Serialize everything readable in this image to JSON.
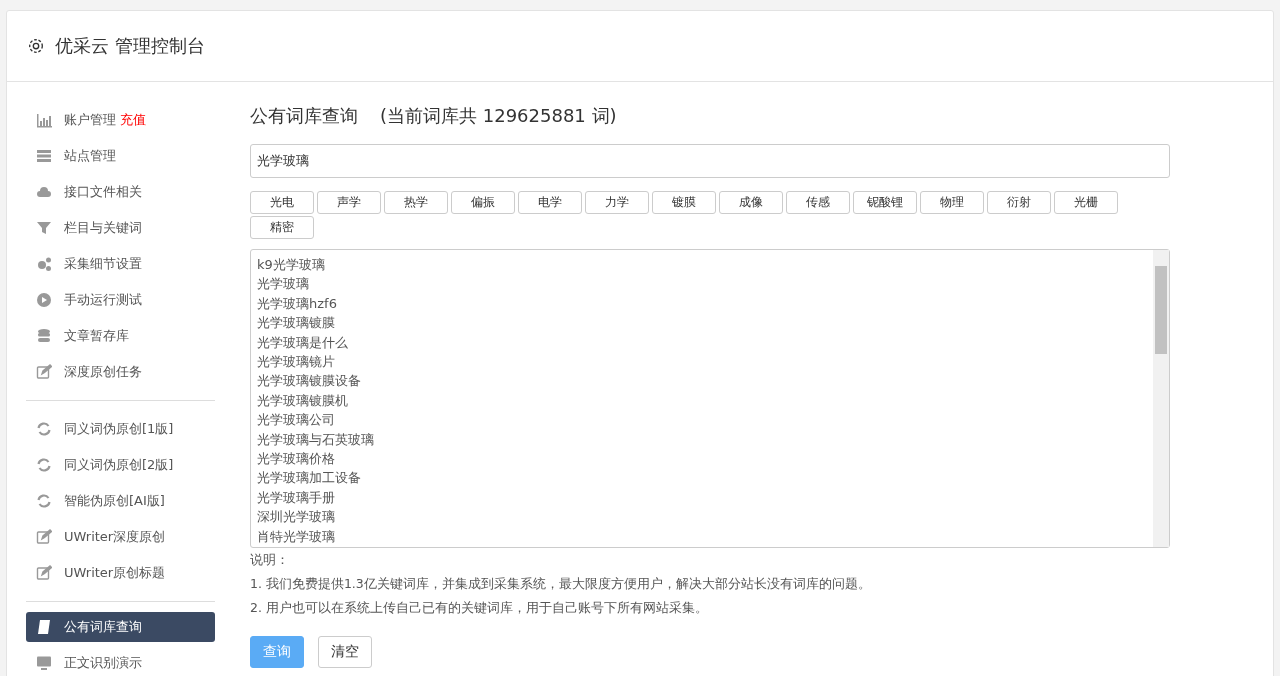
{
  "header": {
    "title": "优采云 管理控制台"
  },
  "sidebar": {
    "groups": [
      [
        {
          "label": "账户管理",
          "badge": "充值",
          "selected": false
        },
        {
          "label": "站点管理",
          "selected": false
        },
        {
          "label": "接口文件相关",
          "selected": false
        },
        {
          "label": "栏目与关键词",
          "selected": false
        },
        {
          "label": "采集细节设置",
          "selected": false
        },
        {
          "label": "手动运行测试",
          "selected": false
        },
        {
          "label": "文章暂存库",
          "selected": false
        },
        {
          "label": "深度原创任务",
          "selected": false
        }
      ],
      [
        {
          "label": "同义词伪原创[1版]",
          "selected": false
        },
        {
          "label": "同义词伪原创[2版]",
          "selected": false
        },
        {
          "label": "智能伪原创[AI版]",
          "selected": false
        },
        {
          "label": "UWriter深度原创",
          "selected": false
        },
        {
          "label": "UWriter原创标题",
          "selected": false
        }
      ],
      [
        {
          "label": "公有词库查询",
          "selected": true
        },
        {
          "label": "正文识别演示",
          "selected": false
        }
      ]
    ]
  },
  "main": {
    "title": "公有词库查询",
    "count_note": "(当前词库共 129625881 词)",
    "search": {
      "value": "光学玻璃"
    },
    "tags": [
      "光电",
      "声学",
      "热学",
      "偏振",
      "电学",
      "力学",
      "镀膜",
      "成像",
      "传感",
      "铌酸锂",
      "物理",
      "衍射",
      "光栅",
      "精密"
    ],
    "results": [
      "k9光学玻璃",
      "光学玻璃",
      "光学玻璃hzf6",
      "光学玻璃镀膜",
      "光学玻璃是什么",
      "光学玻璃镜片",
      "光学玻璃镀膜设备",
      "光学玻璃镀膜机",
      "光学玻璃公司",
      "光学玻璃与石英玻璃",
      "光学玻璃价格",
      "光学玻璃加工设备",
      "光学玻璃手册",
      "深圳光学玻璃",
      "肖特光学玻璃"
    ],
    "notes_title": "说明：",
    "notes": [
      "1. 我们免费提供1.3亿关键词库，并集成到采集系统，最大限度方便用户，解决大部分站长没有词库的问题。",
      "2. 用户也可以在系统上传自己已有的关键词库，用于自己账号下所有网站采集。"
    ],
    "buttons": [
      {
        "label": "查询",
        "kind": "primary"
      },
      {
        "label": "清空",
        "kind": "default"
      }
    ]
  }
}
